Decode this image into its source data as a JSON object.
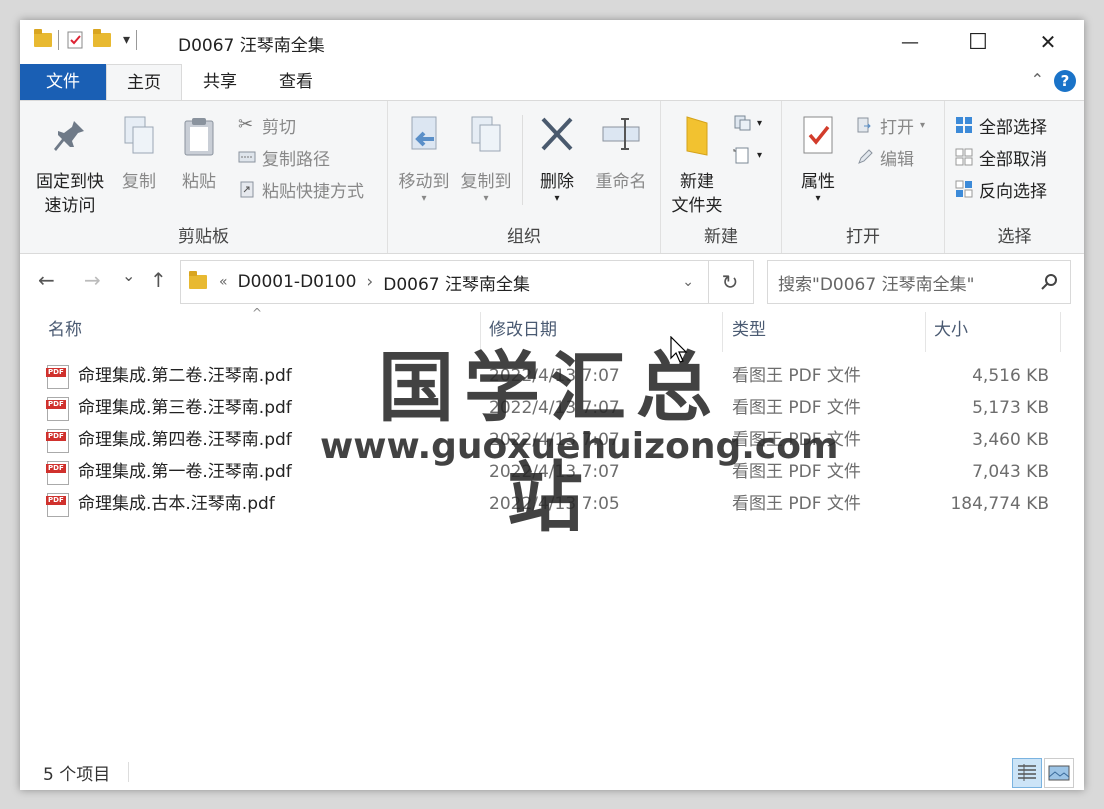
{
  "window": {
    "title": "D0067 汪琴南全集",
    "minimize_glyph": "—",
    "maximize_glyph": "☐",
    "close_glyph": "✕",
    "quick_access_dropdown_glyph": "▾"
  },
  "ribbon_tabs": {
    "file": "文件",
    "home": "主页",
    "share": "共享",
    "view": "查看",
    "help_glyph": "?",
    "collapse_glyph": "⌃"
  },
  "ribbon": {
    "clipboard": {
      "label": "剪贴板",
      "pin_line1": "固定到快",
      "pin_line2": "速访问",
      "copy": "复制",
      "paste": "粘贴",
      "cut": "剪切",
      "copy_path": "复制路径",
      "paste_shortcut": "粘贴快捷方式"
    },
    "organize": {
      "label": "组织",
      "move_to": "移动到",
      "copy_to": "复制到",
      "delete": "删除",
      "rename": "重命名"
    },
    "new": {
      "label": "新建",
      "new_folder_line1": "新建",
      "new_folder_line2": "文件夹"
    },
    "open": {
      "label": "打开",
      "properties": "属性",
      "open": "打开",
      "edit": "编辑"
    },
    "select": {
      "label": "选择",
      "select_all": "全部选择",
      "select_none": "全部取消",
      "invert": "反向选择"
    }
  },
  "nav": {
    "back_glyph": "←",
    "forward_glyph": "→",
    "recent_glyph": "⌄",
    "up_glyph": "↑",
    "breadcrumb_overflow": "«",
    "breadcrumb": [
      "D0001-D0100",
      "D0067 汪琴南全集"
    ],
    "breadcrumb_sep": "›",
    "refresh_glyph": "↻",
    "search_placeholder": "搜索\"D0067 汪琴南全集\"",
    "search_glyph": "⚲"
  },
  "columns": {
    "name": "名称",
    "modified": "修改日期",
    "type": "类型",
    "size": "大小"
  },
  "files": [
    {
      "name": "命理集成.第二卷.汪琴南.pdf",
      "modified": "2022/4/13 7:07",
      "type": "看图王 PDF 文件",
      "size": "4,516 KB"
    },
    {
      "name": "命理集成.第三卷.汪琴南.pdf",
      "modified": "2022/4/13 7:07",
      "type": "看图王 PDF 文件",
      "size": "5,173 KB"
    },
    {
      "name": "命理集成.第四卷.汪琴南.pdf",
      "modified": "2022/4/13 7:07",
      "type": "看图王 PDF 文件",
      "size": "3,460 KB"
    },
    {
      "name": "命理集成.第一卷.汪琴南.pdf",
      "modified": "2022/4/13 7:07",
      "type": "看图王 PDF 文件",
      "size": "7,043 KB"
    },
    {
      "name": "命理集成.古本.汪琴南.pdf",
      "modified": "2022/4/13 7:05",
      "type": "看图王 PDF 文件",
      "size": "184,774 KB"
    }
  ],
  "status": {
    "item_count": "5 个项目"
  },
  "watermark": {
    "title": "国学汇总站",
    "url": "www.guoxuehuizong.com"
  }
}
